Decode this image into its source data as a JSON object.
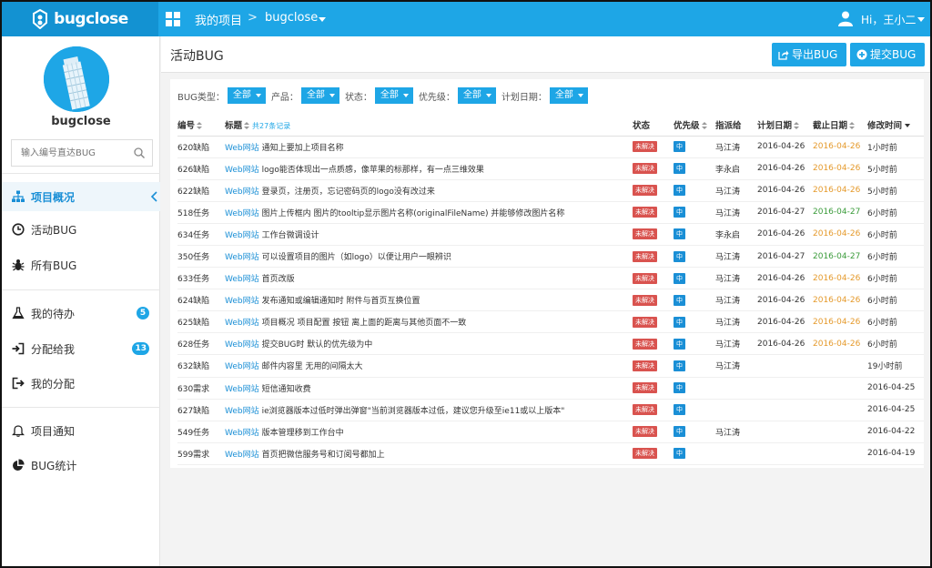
{
  "topbar": {
    "brand": "bugclose",
    "nav_project": "我的项目",
    "nav_separator": ">",
    "nav_current": "bugclose",
    "user_greeting": "Hi，王小二"
  },
  "sidebar": {
    "brand": "bugclose",
    "search_placeholder": "输入编号直达BUG",
    "items": [
      {
        "label": "项目概况",
        "icon": "sitemap-icon",
        "active": true
      },
      {
        "label": "活动BUG",
        "icon": "clock-icon"
      },
      {
        "label": "所有BUG",
        "icon": "bug-icon"
      },
      {
        "label": "我的待办",
        "icon": "flask-icon",
        "badge": "5"
      },
      {
        "label": "分配给我",
        "icon": "sign-in-icon",
        "badge": "13"
      },
      {
        "label": "我的分配",
        "icon": "sign-out-icon"
      },
      {
        "label": "项目通知",
        "icon": "bell-icon"
      },
      {
        "label": "BUG统计",
        "icon": "pie-chart-icon"
      }
    ]
  },
  "header": {
    "title": "活动BUG",
    "export_label": "导出BUG",
    "submit_label": "提交BUG"
  },
  "filters": [
    {
      "label": "BUG类型：",
      "value": "全部"
    },
    {
      "label": "产品：",
      "value": "全部"
    },
    {
      "label": "状态：",
      "value": "全部"
    },
    {
      "label": "优先级：",
      "value": "全部"
    },
    {
      "label": "计划日期：",
      "value": "全部"
    }
  ],
  "table": {
    "columns": {
      "id": "编号",
      "title": "标题",
      "count": "共27条记录",
      "status": "状态",
      "priority": "优先级",
      "assignee": "指派给",
      "plan_date": "计划日期",
      "deadline": "截止日期",
      "modified": "修改时间"
    },
    "rows": [
      {
        "id": "620缺陷",
        "project": "Web网站",
        "title": "通知上要加上项目名称",
        "status": "未解决",
        "priority": "中",
        "assignee": "马江涛",
        "plan": "2016-04-26",
        "deadline": "2016-04-26",
        "deadline_color": "orange",
        "modified": "1小时前"
      },
      {
        "id": "626缺陷",
        "project": "Web网站",
        "title": "logo能否体现出一点质感，像苹果的标那样，有一点三维效果",
        "status": "未解决",
        "priority": "中",
        "assignee": "李永启",
        "plan": "2016-04-26",
        "deadline": "2016-04-26",
        "deadline_color": "orange",
        "modified": "5小时前"
      },
      {
        "id": "622缺陷",
        "project": "Web网站",
        "title": "登录页，注册页，忘记密码页的logo没有改过来",
        "status": "未解决",
        "priority": "中",
        "assignee": "马江涛",
        "plan": "2016-04-26",
        "deadline": "2016-04-26",
        "deadline_color": "orange",
        "modified": "5小时前"
      },
      {
        "id": "518任务",
        "project": "Web网站",
        "title": "图片上传框内 图片的tooltip显示图片名称(originalFileName) 并能够修改图片名称",
        "status": "未解决",
        "priority": "中",
        "assignee": "马江涛",
        "plan": "2016-04-27",
        "deadline": "2016-04-27",
        "deadline_color": "green",
        "modified": "6小时前"
      },
      {
        "id": "634任务",
        "project": "Web网站",
        "title": "工作台微调设计",
        "status": "未解决",
        "priority": "中",
        "assignee": "李永启",
        "plan": "2016-04-26",
        "deadline": "2016-04-26",
        "deadline_color": "orange",
        "modified": "6小时前"
      },
      {
        "id": "350任务",
        "project": "Web网站",
        "title": "可以设置项目的图片（如logo）以便让用户一眼辨识",
        "status": "未解决",
        "priority": "中",
        "assignee": "马江涛",
        "plan": "2016-04-27",
        "deadline": "2016-04-27",
        "deadline_color": "green",
        "modified": "6小时前"
      },
      {
        "id": "633任务",
        "project": "Web网站",
        "title": "首页改版",
        "status": "未解决",
        "priority": "中",
        "assignee": "马江涛",
        "plan": "2016-04-26",
        "deadline": "2016-04-26",
        "deadline_color": "orange",
        "modified": "6小时前"
      },
      {
        "id": "624缺陷",
        "project": "Web网站",
        "title": "发布通知或编辑通知时 附件与首页互换位置",
        "status": "未解决",
        "priority": "中",
        "assignee": "马江涛",
        "plan": "2016-04-26",
        "deadline": "2016-04-26",
        "deadline_color": "orange",
        "modified": "6小时前"
      },
      {
        "id": "625缺陷",
        "project": "Web网站",
        "title": "项目概况 项目配置 按钮 离上面的距离与其他页面不一致",
        "status": "未解决",
        "priority": "中",
        "assignee": "马江涛",
        "plan": "2016-04-26",
        "deadline": "2016-04-26",
        "deadline_color": "orange",
        "modified": "6小时前"
      },
      {
        "id": "628任务",
        "project": "Web网站",
        "title": "提交BUG时 默认的优先级为中",
        "status": "未解决",
        "priority": "中",
        "assignee": "马江涛",
        "plan": "2016-04-26",
        "deadline": "2016-04-26",
        "deadline_color": "orange",
        "modified": "6小时前"
      },
      {
        "id": "632缺陷",
        "project": "Web网站",
        "title": "邮件内容里 无用的间隔太大",
        "status": "未解决",
        "priority": "中",
        "assignee": "马江涛",
        "plan": "",
        "deadline": "",
        "deadline_color": "orange",
        "modified": "19小时前"
      },
      {
        "id": "630需求",
        "project": "Web网站",
        "title": "短信通知收费",
        "status": "未解决",
        "priority": "中",
        "assignee": "",
        "plan": "",
        "deadline": "",
        "deadline_color": "orange",
        "modified": "2016-04-25"
      },
      {
        "id": "627缺陷",
        "project": "Web网站",
        "title": "ie浏览器版本过低时弹出弹窗\"当前浏览器版本过低，建议您升级至ie11或以上版本\"",
        "status": "未解决",
        "priority": "中",
        "assignee": "",
        "plan": "",
        "deadline": "",
        "deadline_color": "orange",
        "modified": "2016-04-25"
      },
      {
        "id": "549任务",
        "project": "Web网站",
        "title": "版本管理移到工作台中",
        "status": "未解决",
        "priority": "中",
        "assignee": "马江涛",
        "plan": "",
        "deadline": "",
        "deadline_color": "orange",
        "modified": "2016-04-22"
      },
      {
        "id": "599需求",
        "project": "Web网站",
        "title": "首页把微信服务号和订阅号都加上",
        "status": "未解决",
        "priority": "中",
        "assignee": "",
        "plan": "",
        "deadline": "",
        "deadline_color": "orange",
        "modified": "2016-04-19"
      }
    ]
  },
  "colors": {
    "brand_blue": "#1ea6e6",
    "logo_bg": "#1392d2",
    "status_red": "#d9534f",
    "deadline_orange": "#e59a2c",
    "deadline_green": "#3a9b3a"
  }
}
